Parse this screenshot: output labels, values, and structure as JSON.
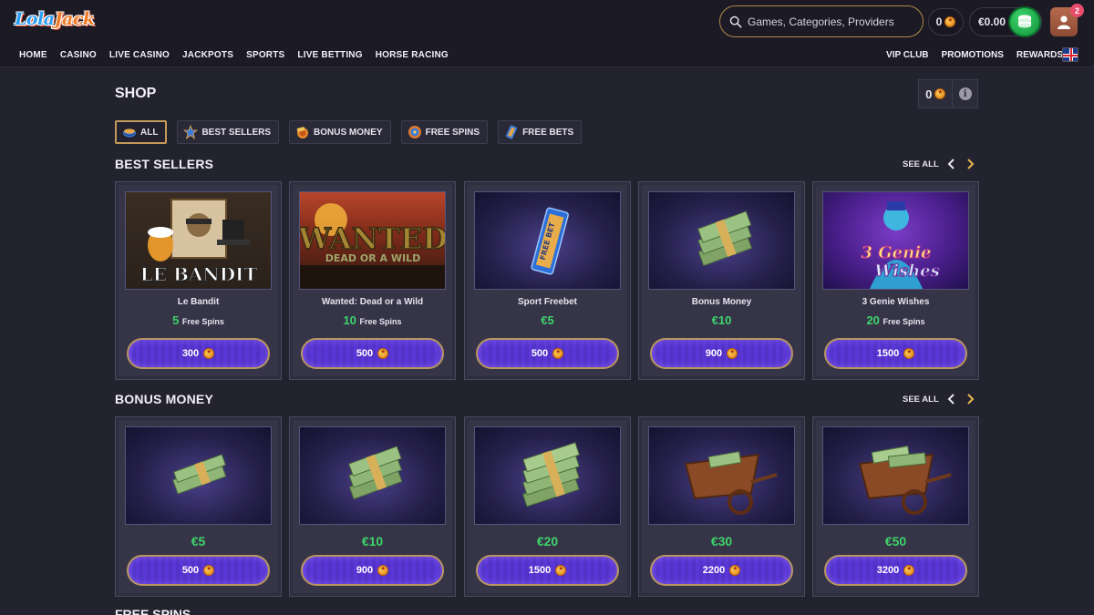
{
  "brand": {
    "logo_part1": "Lola",
    "logo_part2": "Jack"
  },
  "nav": {
    "main": [
      "HOME",
      "CASINO",
      "LIVE CASINO",
      "JACKPOTS",
      "SPORTS",
      "LIVE BETTING",
      "HORSE RACING"
    ],
    "right": [
      "VIP CLUB",
      "PROMOTIONS",
      "REWARDS"
    ]
  },
  "header": {
    "search_placeholder": "Games, Categories, Providers",
    "coin_balance": "0",
    "cash_balance": "€0.00",
    "notification_count": "2"
  },
  "page": {
    "title": "SHOP",
    "shop_coins": "0"
  },
  "filters": [
    "ALL",
    "BEST SELLERS",
    "BONUS MONEY",
    "FREE SPINS",
    "FREE BETS"
  ],
  "sections": {
    "best_sellers": {
      "title": "BEST SELLERS",
      "see_all": "SEE ALL",
      "items": [
        {
          "name": "Le Bandit",
          "amount": "5",
          "unit": "Free Spins",
          "price": "300",
          "image": "le-bandit-game"
        },
        {
          "name": "Wanted: Dead or a Wild",
          "amount": "10",
          "unit": "Free Spins",
          "price": "500",
          "image": "wanted-game"
        },
        {
          "name": "Sport Freebet",
          "amount": "€5",
          "unit": "",
          "price": "500",
          "image": "free-bet-ticket"
        },
        {
          "name": "Bonus Money",
          "amount": "€10",
          "unit": "",
          "price": "900",
          "image": "money-stack"
        },
        {
          "name": "3 Genie Wishes",
          "amount": "20",
          "unit": "Free Spins",
          "price": "1500",
          "image": "genie-game"
        }
      ]
    },
    "bonus_money": {
      "title": "BONUS MONEY",
      "see_all": "SEE ALL",
      "items": [
        {
          "amount": "€5",
          "price": "500",
          "image": "money-stack-small"
        },
        {
          "amount": "€10",
          "price": "900",
          "image": "money-stack-medium"
        },
        {
          "amount": "€20",
          "price": "1500",
          "image": "money-stack-large"
        },
        {
          "amount": "€30",
          "price": "2200",
          "image": "money-cart"
        },
        {
          "amount": "€50",
          "price": "3200",
          "image": "money-cart-full"
        }
      ]
    },
    "free_spins": {
      "title": "FREE SPINS"
    }
  },
  "colors": {
    "background": "#23222f",
    "accent_gold": "#b89660",
    "button_purple": "#5b36d6",
    "reward_green": "#3ed46a"
  }
}
